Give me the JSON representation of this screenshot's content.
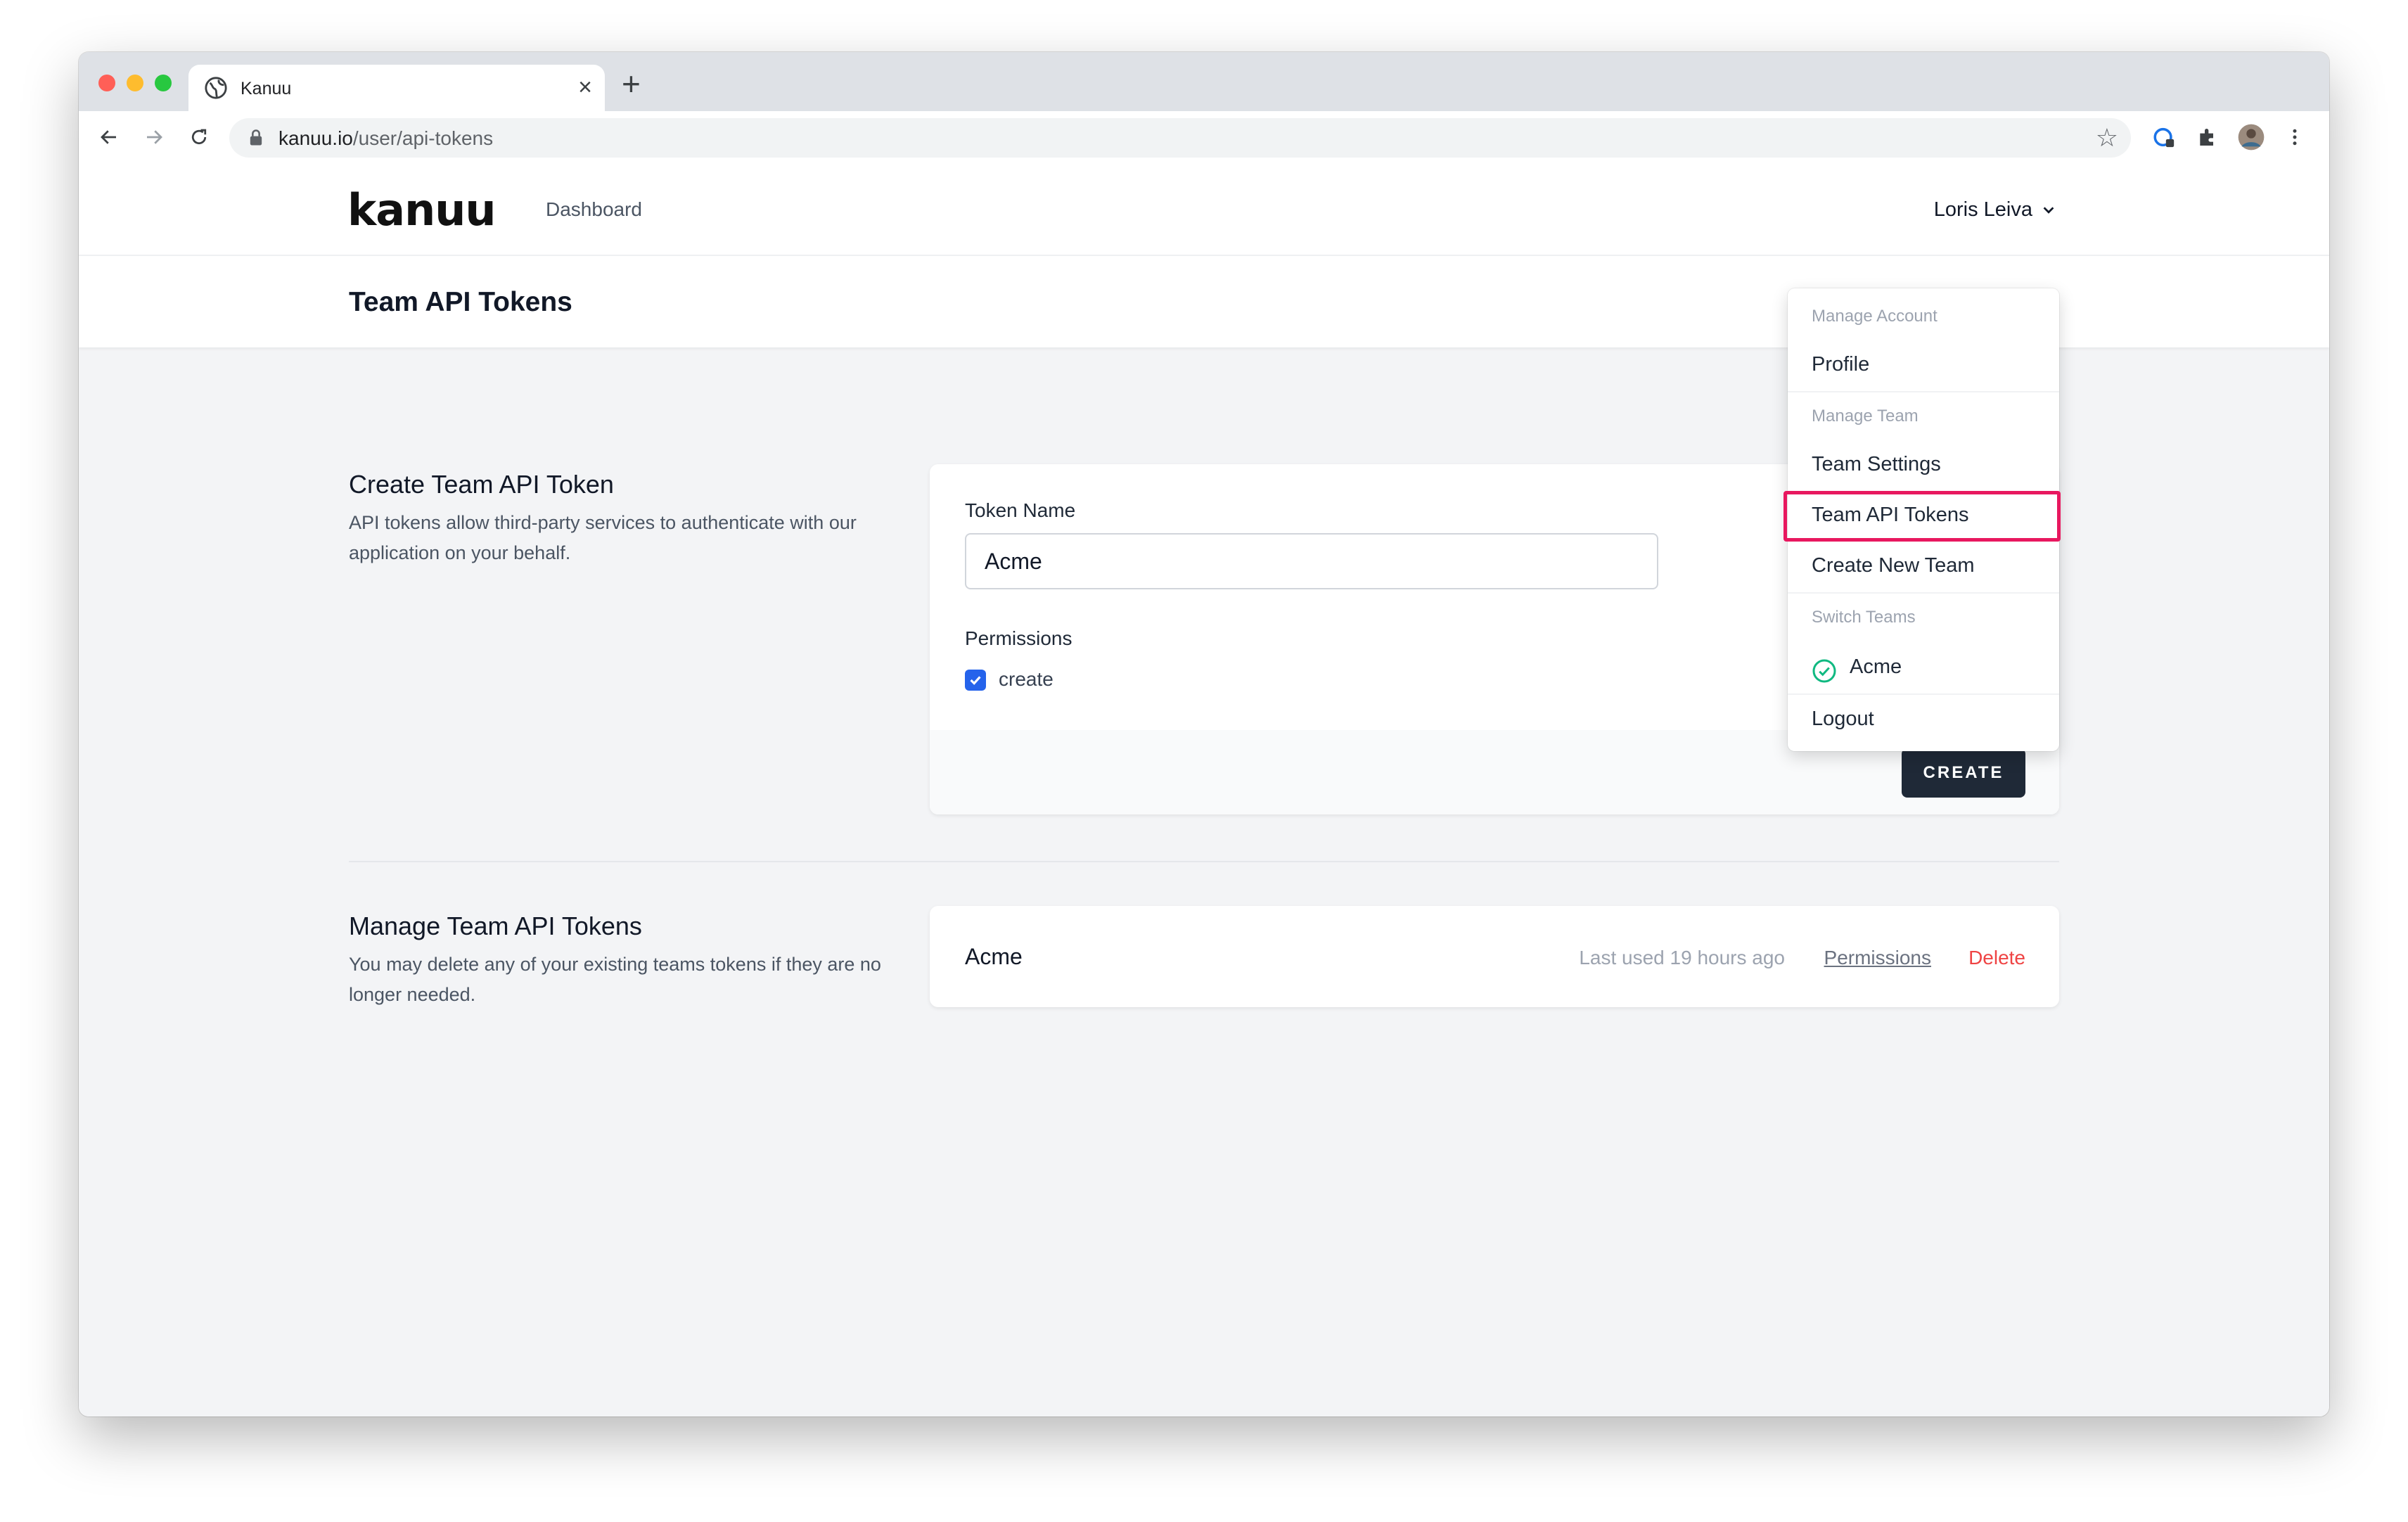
{
  "browser": {
    "tab_title": "Kanuu",
    "url_host": "kanuu.io",
    "url_path": "/user/api-tokens"
  },
  "nav": {
    "logo": "kanuu",
    "dashboard": "Dashboard",
    "user_name": "Loris Leiva"
  },
  "page": {
    "title": "Team API Tokens"
  },
  "create_section": {
    "title": "Create Team API Token",
    "description": "API tokens allow third-party services to authenticate with our application on your behalf.",
    "token_name_label": "Token Name",
    "token_name_value": "Acme",
    "permissions_label": "Permissions",
    "permissions": [
      {
        "label": "create",
        "checked": true
      }
    ],
    "create_button": "CREATE"
  },
  "manage_section": {
    "title": "Manage Team API Tokens",
    "description": "You may delete any of your existing teams tokens if they are no longer needed.",
    "tokens": [
      {
        "name": "Acme",
        "last_used": "Last used 19 hours ago",
        "permissions_link": "Permissions",
        "delete_link": "Delete"
      }
    ]
  },
  "dropdown": {
    "manage_account": "Manage Account",
    "profile": "Profile",
    "manage_team": "Manage Team",
    "team_settings": "Team Settings",
    "team_api_tokens": "Team API Tokens",
    "create_new_team": "Create New Team",
    "switch_teams": "Switch Teams",
    "current_team": "Acme",
    "logout": "Logout"
  },
  "colors": {
    "highlight": "#e8185f",
    "primary_button": "#1f2937",
    "checkbox": "#2563eb",
    "delete": "#ef4444",
    "team_check": "#10b981"
  }
}
